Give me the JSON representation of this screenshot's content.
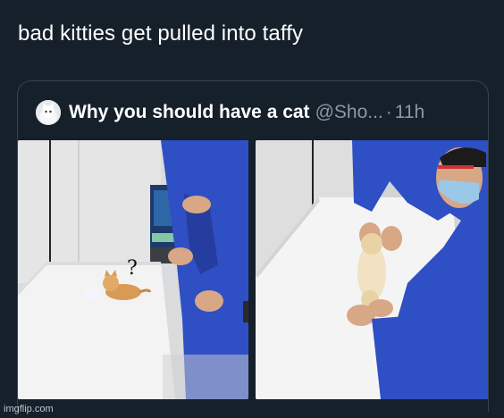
{
  "caption": "bad kitties get pulled into taffy",
  "tweet": {
    "name": "Why you should have a cat",
    "handle": "@Sho...",
    "separator": "·",
    "time": "11h",
    "question_mark": "?"
  },
  "watermark": "imgflip.com",
  "colors": {
    "background": "#15202b",
    "border": "#38444d",
    "muted_text": "#8899a6",
    "scrub_blue": "#2f4fc4"
  }
}
